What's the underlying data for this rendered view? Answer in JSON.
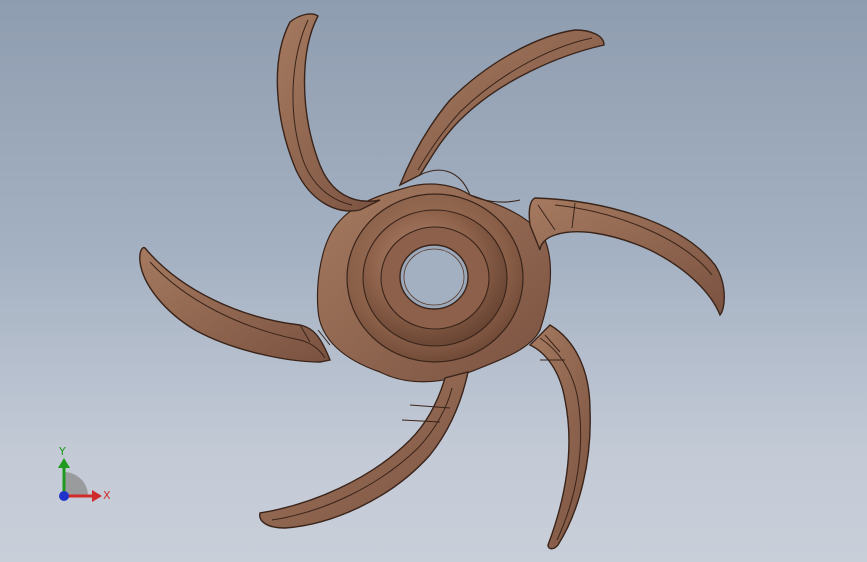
{
  "viewport": {
    "background_top": "#8f9db0",
    "background_bottom": "#c9cfd9"
  },
  "model": {
    "name": "impeller",
    "blade_count": 6,
    "material_color": "#8a6048",
    "edge_color": "#3a241a"
  },
  "triad": {
    "x_label": "X",
    "y_label": "Y",
    "x_color": "#d12a2a",
    "y_color": "#1f9a1f",
    "z_color": "#2233cc"
  }
}
